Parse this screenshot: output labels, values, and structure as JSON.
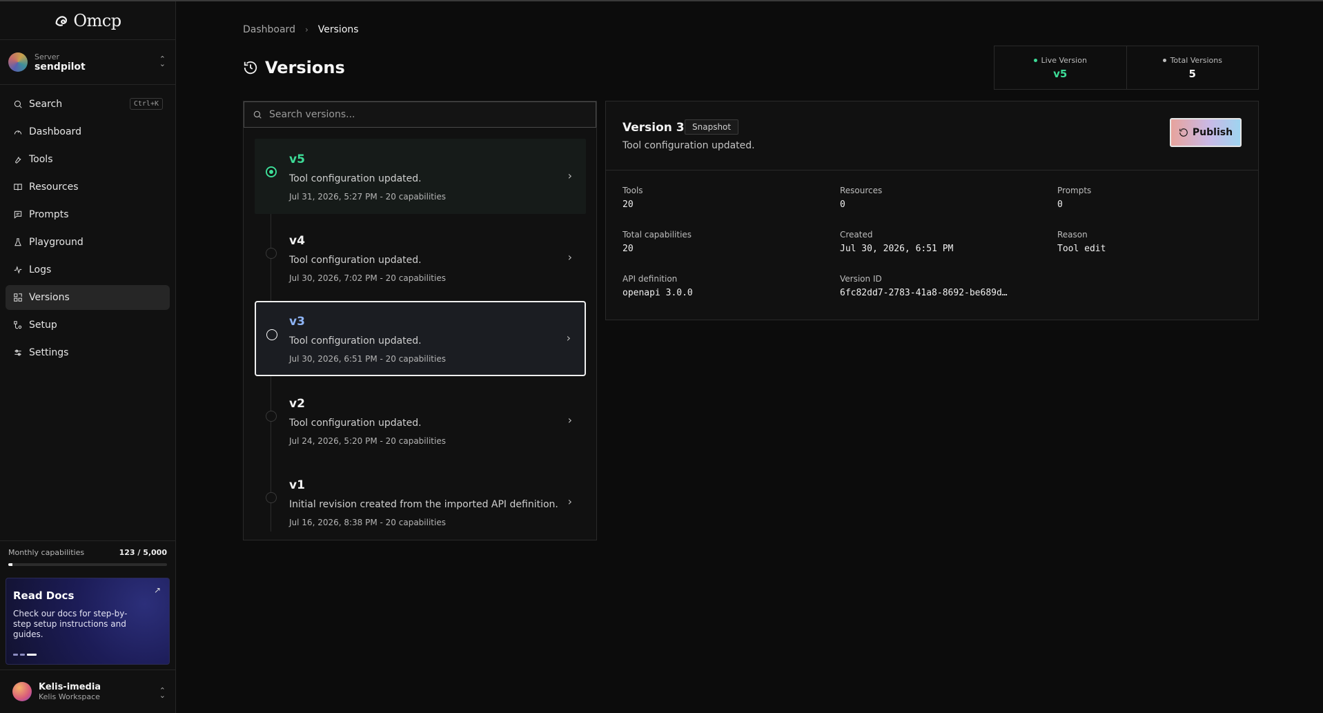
{
  "app": {
    "logo_text": "Omcp"
  },
  "server": {
    "label": "Server",
    "name": "sendpilot"
  },
  "nav": [
    {
      "label": "Search",
      "icon": "search-icon",
      "shortcut": "Ctrl+K"
    },
    {
      "label": "Dashboard",
      "icon": "dashboard-icon"
    },
    {
      "label": "Tools",
      "icon": "wrench-icon"
    },
    {
      "label": "Resources",
      "icon": "book-icon"
    },
    {
      "label": "Prompts",
      "icon": "message-icon"
    },
    {
      "label": "Playground",
      "icon": "flask-icon"
    },
    {
      "label": "Logs",
      "icon": "activity-icon"
    },
    {
      "label": "Versions",
      "icon": "versions-icon",
      "active": true
    },
    {
      "label": "Setup",
      "icon": "setup-icon"
    },
    {
      "label": "Settings",
      "icon": "sliders-icon"
    }
  ],
  "usage": {
    "label": "Monthly capabilities",
    "value": "123 / 5,000",
    "fraction": 0.0246
  },
  "docs": {
    "title": "Read Docs",
    "text": "Check our docs for step-by-step setup instructions and guides."
  },
  "account": {
    "name": "Kelis-imedia",
    "workspace": "Kelis Workspace"
  },
  "breadcrumb": {
    "parent": "Dashboard",
    "current": "Versions"
  },
  "page": {
    "title": "Versions"
  },
  "stats": {
    "live_label": "Live Version",
    "live_value": "v5",
    "total_label": "Total Versions",
    "total_value": "5"
  },
  "search": {
    "placeholder": "Search versions..."
  },
  "versions": [
    {
      "name": "v5",
      "desc": "Tool configuration updated.",
      "meta": "Jul 31, 2026, 5:27 PM - 20 capabilities"
    },
    {
      "name": "v4",
      "desc": "Tool configuration updated.",
      "meta": "Jul 30, 2026, 7:02 PM - 20 capabilities"
    },
    {
      "name": "v3",
      "desc": "Tool configuration updated.",
      "meta": "Jul 30, 2026, 6:51 PM - 20 capabilities"
    },
    {
      "name": "v2",
      "desc": "Tool configuration updated.",
      "meta": "Jul 24, 2026, 5:20 PM - 20 capabilities"
    },
    {
      "name": "v1",
      "desc": "Initial revision created from the imported API definition.",
      "meta": "Jul 16, 2026, 8:38 PM - 20 capabilities"
    }
  ],
  "detail": {
    "title": "Version 3",
    "badge": "Snapshot",
    "subtitle": "Tool configuration updated.",
    "publish_label": "Publish",
    "fields": [
      {
        "label": "Tools",
        "value": "20"
      },
      {
        "label": "Resources",
        "value": "0"
      },
      {
        "label": "Prompts",
        "value": "0"
      },
      {
        "label": "Total capabilities",
        "value": "20"
      },
      {
        "label": "Created",
        "value": "Jul 30, 2026, 6:51 PM"
      },
      {
        "label": "Reason",
        "value": "Tool edit"
      },
      {
        "label": "API definition",
        "value": "openapi 3.0.0"
      },
      {
        "label": "Version ID",
        "value": "6fc82dd7-2783-41a8-8692-be689d…"
      }
    ]
  },
  "colors": {
    "live_green": "#3ddc97",
    "selected_blue": "#8eb4f5",
    "background": "#0c0c0c"
  }
}
